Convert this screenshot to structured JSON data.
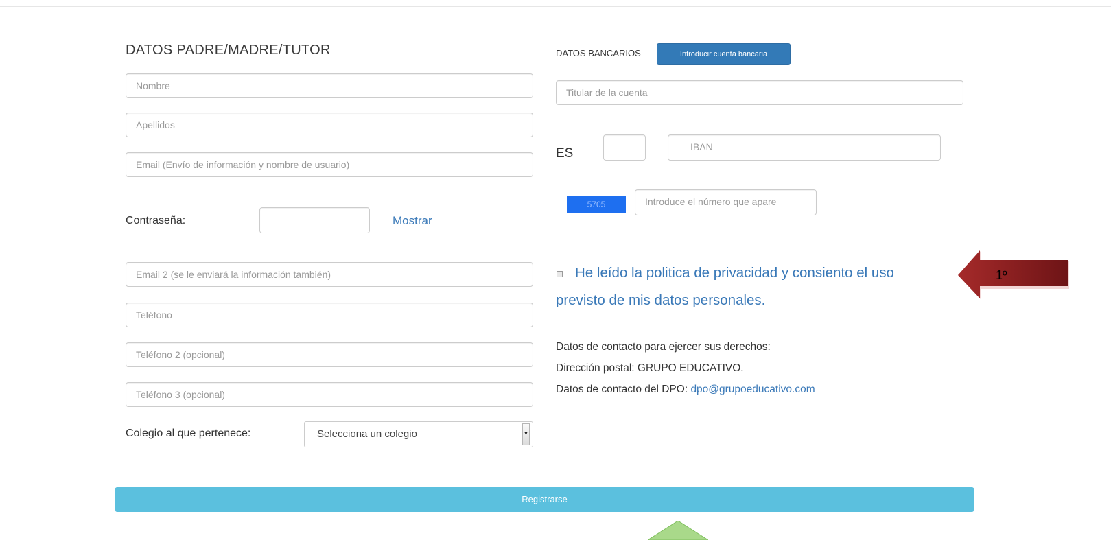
{
  "parent_section": {
    "title": "DATOS PADRE/MADRE/TUTOR",
    "nombre_placeholder": "Nombre",
    "apellidos_placeholder": "Apellidos",
    "email_placeholder": "Email (Envío de información y nombre de usuario)",
    "password_label": "Contraseña:",
    "password_value": "",
    "show_password": "Mostrar",
    "email2_placeholder": "Email 2 (se le enviará la información también)",
    "telefono_placeholder": "Teléfono",
    "telefono2_placeholder": "Teléfono 2 (opcional)",
    "telefono3_placeholder": "Teléfono 3 (opcional)",
    "colegio_label": "Colegio al que pertenece:",
    "colegio_selected": "Selecciona un colegio"
  },
  "bank_section": {
    "title": "DATOS BANCARIOS",
    "add_account_button": "Introducir cuenta bancaria",
    "titular_placeholder": "Titular de la cuenta",
    "country_prefix": "ES",
    "control_value": "",
    "iban_placeholder": "IBAN",
    "captcha_code": "5705",
    "captcha_placeholder": "Introduce el número que apare"
  },
  "consent": {
    "line1": "He leído la politica de privacidad y consiento el uso",
    "line2": "previsto de mis datos personales."
  },
  "contact": {
    "line1": "Datos de contacto para ejercer sus derechos:",
    "line2": "Dirección postal: GRUPO EDUCATIVO.",
    "line3_prefix": "Datos de contacto del DPO: ",
    "line3_email": "dpo@grupoeducativo.com"
  },
  "register_button": "Registrarse",
  "annotation": {
    "step_label": "1º",
    "red_arrow_color": "#8b1e22",
    "green_arrow_color": "#a9d98a"
  },
  "colors": {
    "primary_button": "#337ab7",
    "register_button": "#5bc0de",
    "link": "#3a79b8",
    "captcha_bg": "#1e6ff0"
  }
}
